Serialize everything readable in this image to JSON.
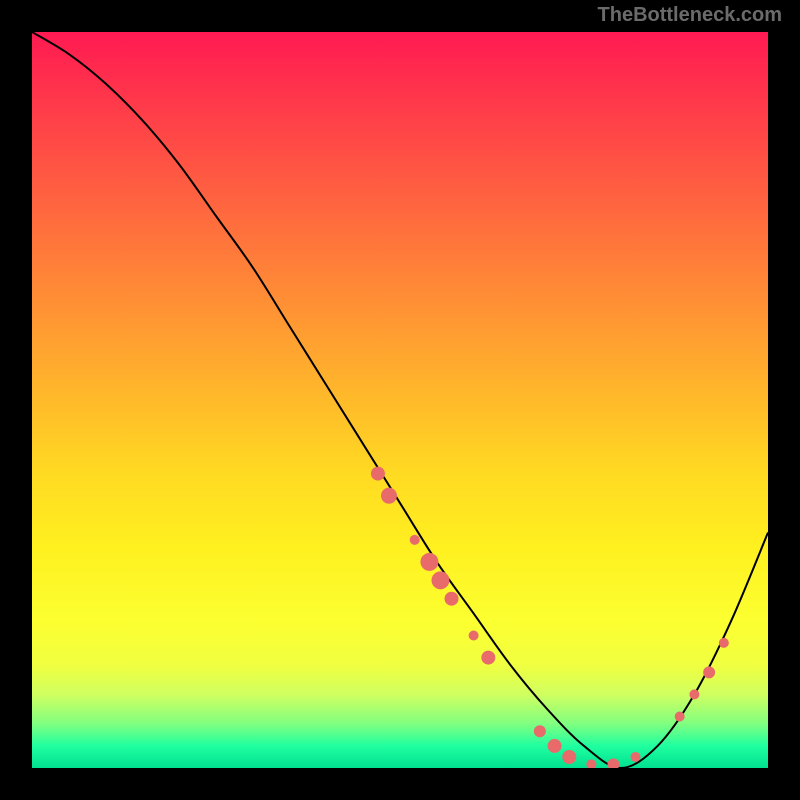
{
  "watermark": "TheBottleneck.com",
  "chart_data": {
    "type": "line",
    "title": "",
    "xlabel": "",
    "ylabel": "",
    "xlim": [
      0,
      100
    ],
    "ylim": [
      0,
      100
    ],
    "grid": false,
    "series": [
      {
        "name": "curve",
        "x": [
          0,
          5,
          10,
          15,
          20,
          25,
          30,
          35,
          40,
          45,
          50,
          55,
          60,
          65,
          70,
          75,
          80,
          85,
          90,
          95,
          100
        ],
        "y": [
          100,
          97,
          93,
          88,
          82,
          75,
          68,
          60,
          52,
          44,
          36,
          28,
          21,
          14,
          8,
          3,
          0,
          3,
          10,
          20,
          32
        ]
      }
    ],
    "markers": [
      {
        "x": 47,
        "y": 40,
        "r": 7
      },
      {
        "x": 48.5,
        "y": 37,
        "r": 8
      },
      {
        "x": 52,
        "y": 31,
        "r": 5
      },
      {
        "x": 54,
        "y": 28,
        "r": 9
      },
      {
        "x": 55.5,
        "y": 25.5,
        "r": 9
      },
      {
        "x": 57,
        "y": 23,
        "r": 7
      },
      {
        "x": 60,
        "y": 18,
        "r": 5
      },
      {
        "x": 62,
        "y": 15,
        "r": 7
      },
      {
        "x": 69,
        "y": 5,
        "r": 6
      },
      {
        "x": 71,
        "y": 3,
        "r": 7
      },
      {
        "x": 73,
        "y": 1.5,
        "r": 7
      },
      {
        "x": 76,
        "y": 0.5,
        "r": 5
      },
      {
        "x": 79,
        "y": 0.5,
        "r": 6
      },
      {
        "x": 82,
        "y": 1.5,
        "r": 5
      },
      {
        "x": 88,
        "y": 7,
        "r": 5
      },
      {
        "x": 90,
        "y": 10,
        "r": 5
      },
      {
        "x": 92,
        "y": 13,
        "r": 6
      },
      {
        "x": 94,
        "y": 17,
        "r": 5
      }
    ],
    "background_gradient": {
      "top": "#ff1a52",
      "mid": "#ffe020",
      "bottom": "#00e090"
    }
  }
}
